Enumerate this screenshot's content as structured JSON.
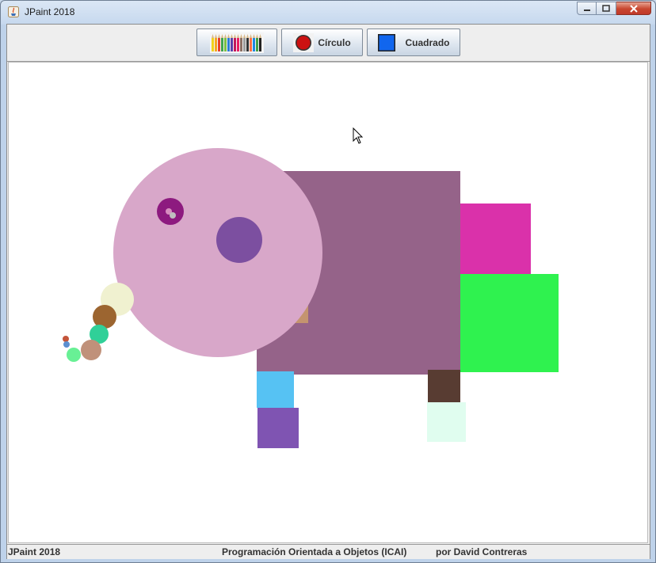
{
  "window": {
    "title": "JPaint 2018"
  },
  "toolbar": {
    "colors_button_icon": "colored-pencils-icon",
    "circle_label": "Círculo",
    "circle_icon": "red-circle-icon",
    "circle_color": "#cc1111",
    "square_label": "Cuadrado",
    "square_icon": "blue-square-icon",
    "square_color": "#1166ee"
  },
  "canvas": {
    "background": "#ffffff",
    "shape_colors": [
      "#956389",
      "#da31aa",
      "#2ff24f",
      "#56c2f3",
      "#7f54b2",
      "#583c32",
      "#e0fdef",
      "#d8a7c9",
      "#7c4fa0",
      "#8d1a7f",
      "#f0f1d0",
      "#9c6530",
      "#30d098",
      "#c0917a",
      "#68f095"
    ]
  },
  "statusbar": {
    "app": "JPaint 2018",
    "course": "Programación Orientada a Objetos (ICAI)",
    "author": "por David Contreras"
  }
}
